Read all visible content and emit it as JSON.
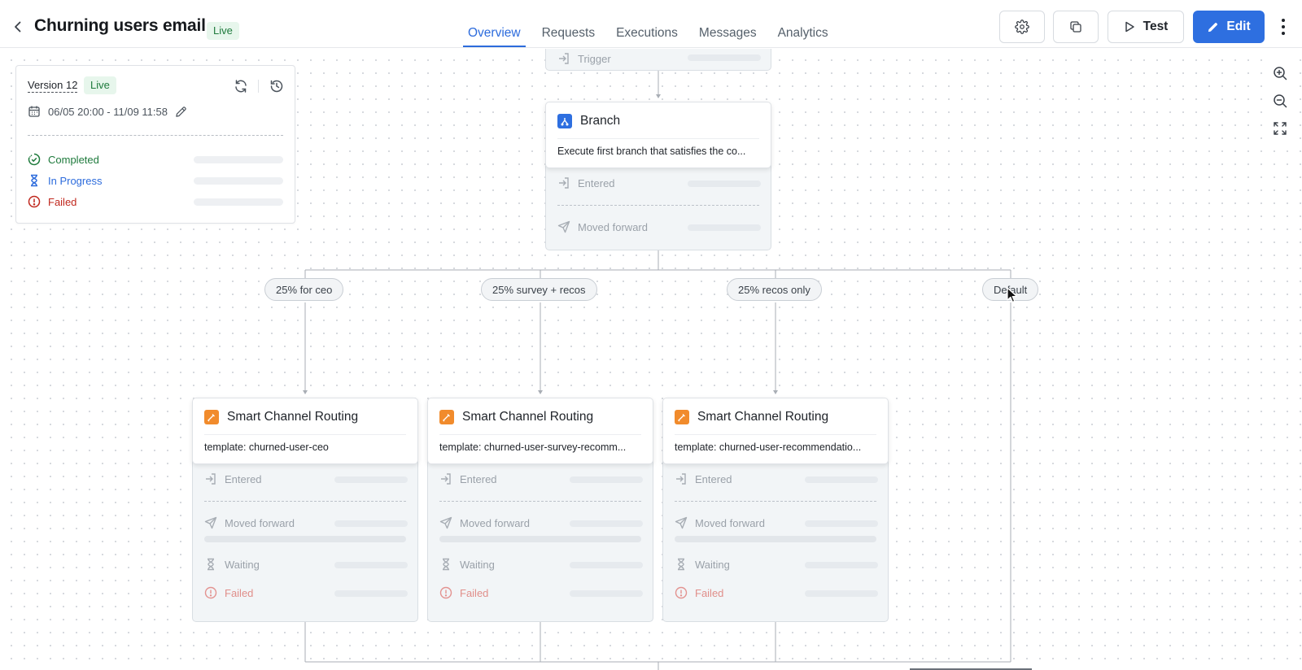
{
  "header": {
    "title": "Churning users email",
    "status": "Live",
    "tabs": [
      {
        "label": "Overview",
        "active": true
      },
      {
        "label": "Requests",
        "active": false
      },
      {
        "label": "Executions",
        "active": false
      },
      {
        "label": "Messages",
        "active": false
      },
      {
        "label": "Analytics",
        "active": false
      }
    ],
    "test_label": "Test",
    "edit_label": "Edit"
  },
  "version_panel": {
    "version": "Version 12",
    "status": "Live",
    "date_range": "06/05 20:00 - 11/09 11:58",
    "stats": [
      {
        "label": "Completed",
        "color": "#1e7a3c"
      },
      {
        "label": "In Progress",
        "color": "#2c6bdc"
      },
      {
        "label": "Failed",
        "color": "#c0271d"
      }
    ]
  },
  "trigger_node": {
    "metric_label": "Trigger"
  },
  "branch_node": {
    "title": "Branch",
    "description": "Execute first branch that satisfies the co...",
    "metrics": [
      "Entered",
      "Moved forward"
    ]
  },
  "branches": [
    {
      "label": "25% for ceo"
    },
    {
      "label": "25% survey + recos"
    },
    {
      "label": "25% recos only"
    },
    {
      "label": "Default"
    }
  ],
  "routing_nodes": [
    {
      "title": "Smart Channel Routing",
      "description": "template: churned-user-ceo",
      "metrics": {
        "entered": "Entered",
        "moved": "Moved forward",
        "waiting": "Waiting",
        "failed": "Failed"
      }
    },
    {
      "title": "Smart Channel Routing",
      "description": "template: churned-user-survey-recomm...",
      "metrics": {
        "entered": "Entered",
        "moved": "Moved forward",
        "waiting": "Waiting",
        "failed": "Failed"
      }
    },
    {
      "title": "Smart Channel Routing",
      "description": "template: churned-user-recommendatio...",
      "metrics": {
        "entered": "Entered",
        "moved": "Moved forward",
        "waiting": "Waiting",
        "failed": "Failed"
      }
    }
  ],
  "colors": {
    "accent": "#2e6fe0",
    "live_bg": "#e7f6ec",
    "live_text": "#1e7a3c",
    "routing_icon": "#f18b2c",
    "failed": "#c0271d"
  }
}
